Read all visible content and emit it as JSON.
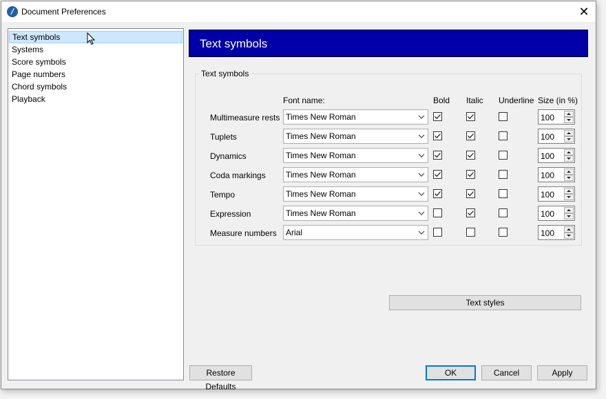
{
  "window": {
    "title": "Document Preferences",
    "close_glyph": "✕"
  },
  "sidebar": {
    "items": [
      {
        "label": "Text symbols",
        "selected": true
      },
      {
        "label": "Systems"
      },
      {
        "label": "Score symbols"
      },
      {
        "label": "Page numbers"
      },
      {
        "label": "Chord symbols"
      },
      {
        "label": "Playback"
      }
    ]
  },
  "panel": {
    "header": "Text symbols",
    "header_color": "#0000a8",
    "group_label": "Text symbols",
    "columns": {
      "font_name": "Font name:",
      "bold": "Bold",
      "italic": "Italic",
      "underline": "Underline",
      "size": "Size (in %)"
    },
    "rows": [
      {
        "label": "Multimeasure rests",
        "font": "Times New Roman",
        "bold": true,
        "italic": true,
        "underline": false,
        "size": "100"
      },
      {
        "label": "Tuplets",
        "font": "Times New Roman",
        "bold": true,
        "italic": true,
        "underline": false,
        "size": "100"
      },
      {
        "label": "Dynamics",
        "font": "Times New Roman",
        "bold": true,
        "italic": true,
        "underline": false,
        "size": "100"
      },
      {
        "label": "Coda markings",
        "font": "Times New Roman",
        "bold": true,
        "italic": true,
        "underline": false,
        "size": "100"
      },
      {
        "label": "Tempo",
        "font": "Times New Roman",
        "bold": true,
        "italic": true,
        "underline": false,
        "size": "100"
      },
      {
        "label": "Expression",
        "font": "Times New Roman",
        "bold": false,
        "italic": true,
        "underline": false,
        "size": "100"
      },
      {
        "label": "Measure numbers",
        "font": "Arial",
        "bold": false,
        "italic": false,
        "underline": false,
        "size": "100"
      }
    ],
    "text_styles_button": "Text styles"
  },
  "footer": {
    "restore_defaults": "Restore Defaults",
    "ok": "OK",
    "cancel": "Cancel",
    "apply": "Apply"
  }
}
